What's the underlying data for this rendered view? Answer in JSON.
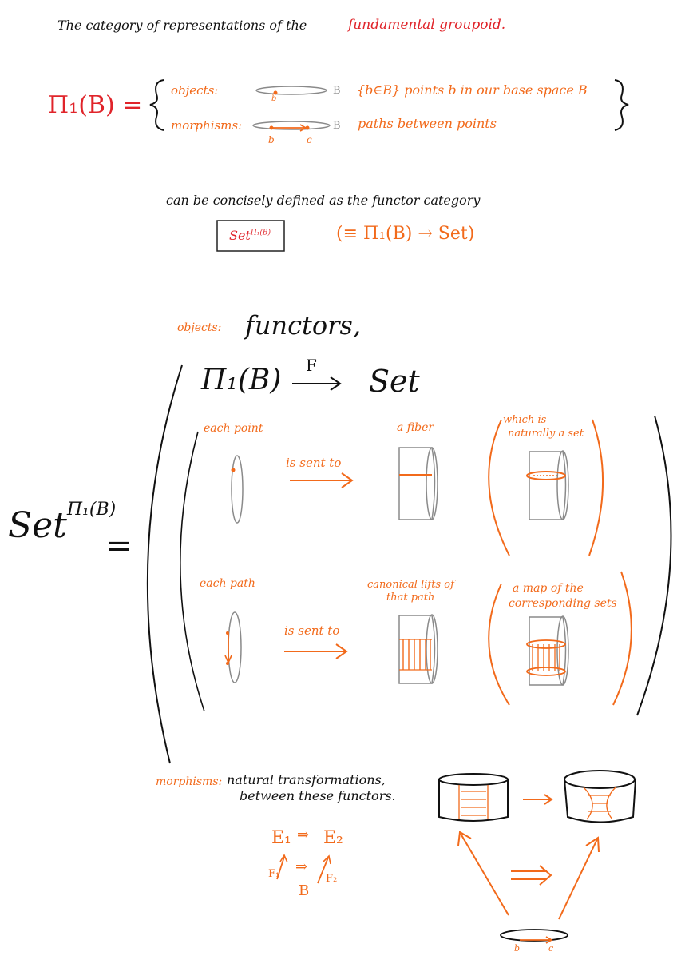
{
  "colors": {
    "ink": "#111111",
    "accent": "#f26a1b",
    "red": "#e0242a",
    "gray": "#8a8a8a"
  },
  "header": {
    "title_prefix": "The category of representations of the",
    "title_highlight": "fundamental groupoid."
  },
  "definition": {
    "pi1_symbol": "Π₁(B) =",
    "objects_label": "objects:",
    "objects_desc": "{b∈B} points b in our base space B",
    "morphisms_label": "morphisms:",
    "morphisms_desc": "paths between points",
    "base_letter": "B",
    "point_b": "b",
    "point_c": "c"
  },
  "concise": {
    "text": "can be concisely defined as the functor category",
    "boxed_base": "Set",
    "boxed_exp": "Π₁(B)",
    "equiv": "(≡ Π₁(B) → Set)"
  },
  "functor_section": {
    "objects_label": "objects:",
    "functors_text": "functors,",
    "functor_left": "Π₁(B)",
    "functor_arrow_label": "F",
    "functor_right": "Set",
    "set_base": "Set",
    "set_exp": "Π₁(B)",
    "equals": "=",
    "row1": {
      "col1": "each point",
      "arrow": "is sent to",
      "col2": "a fiber",
      "col3_line1": "which is",
      "col3_line2": "naturally a set"
    },
    "row2": {
      "col1": "each path",
      "arrow": "is sent to",
      "col2_line1": "canonical lifts of",
      "col2_line2": "that path",
      "col3_line1": "a map of the",
      "col3_line2": "corresponding sets"
    }
  },
  "morphisms_section": {
    "label": "morphisms:",
    "text_line1": "natural transformations,",
    "text_line2": "between these functors.",
    "e1": "E₁",
    "e2": "E₂",
    "f1": "F₁",
    "f2": "F₂",
    "base": "B",
    "double_arrow": "⇒",
    "point_b": "b",
    "point_c": "c"
  }
}
